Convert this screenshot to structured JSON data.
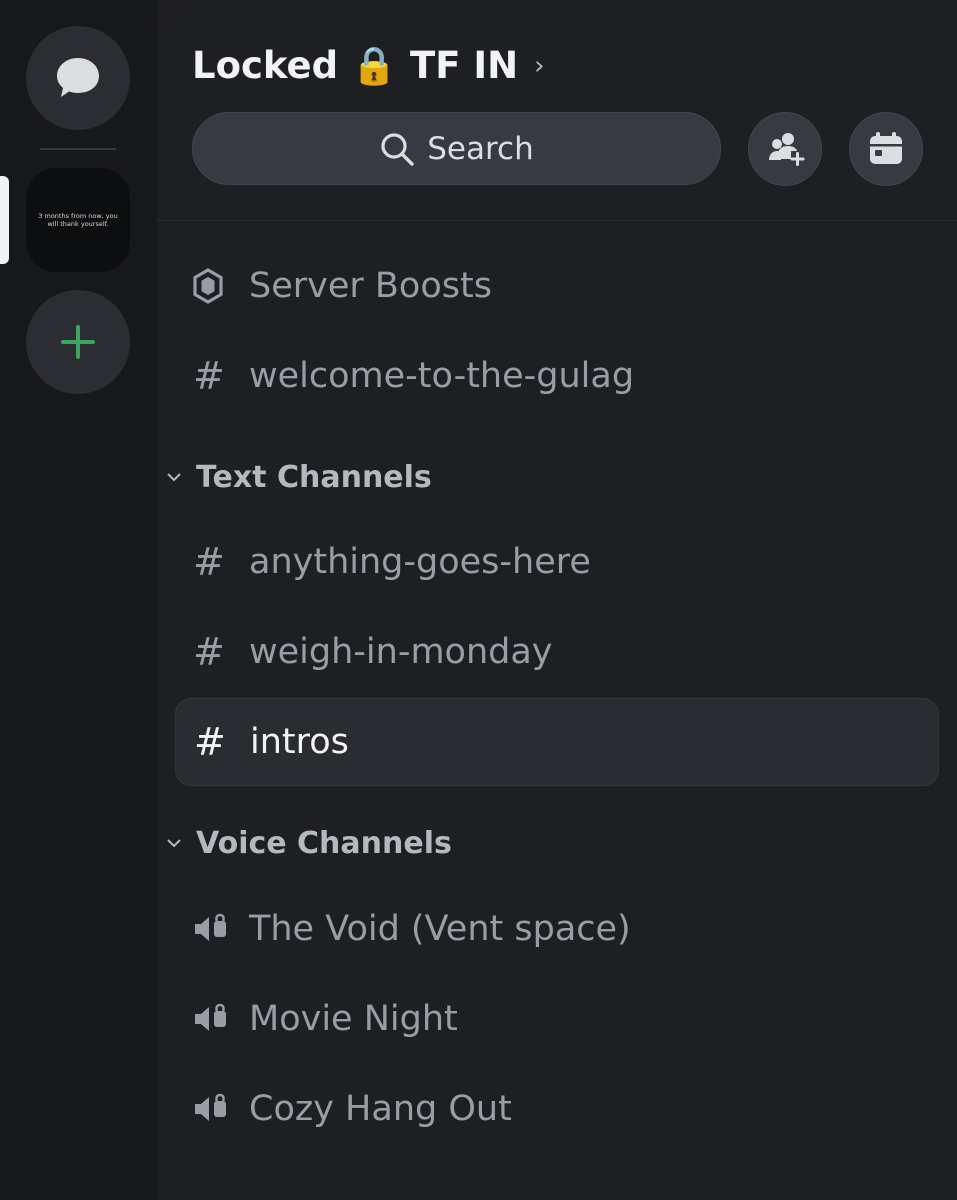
{
  "server": {
    "name": "Locked 🔒 TF IN",
    "icon_text": "3 months from now, you will thank yourself."
  },
  "search": {
    "label": "Search"
  },
  "top_items": [
    {
      "icon": "boost-icon",
      "label": "Server Boosts"
    },
    {
      "icon": "hash-icon",
      "label": "welcome-to-the-gulag"
    }
  ],
  "categories": {
    "text": {
      "label": "Text Channels",
      "channels": [
        {
          "label": "anything-goes-here"
        },
        {
          "label": "weigh-in-monday"
        },
        {
          "label": "intros",
          "selected": true
        }
      ]
    },
    "voice": {
      "label": "Voice Channels",
      "channels": [
        {
          "label": "The Void (Vent space)"
        },
        {
          "label": "Movie Night"
        },
        {
          "label": "Cozy Hang Out"
        }
      ]
    }
  },
  "colors": {
    "accent_green": "#3ba55c",
    "background": "#1e1f23",
    "rail": "#17181c"
  }
}
